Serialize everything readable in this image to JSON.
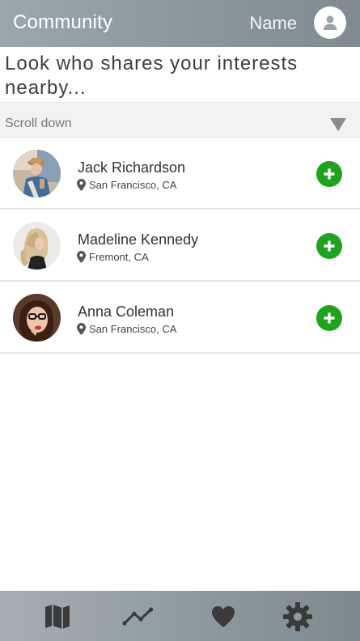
{
  "header": {
    "title": "Community",
    "user_label": "Name"
  },
  "intro_text": "Look who shares your interests nearby...",
  "scroll_bar": {
    "label": "Scroll down"
  },
  "people": [
    {
      "name": "Jack Richardson",
      "location": "San Francisco, CA"
    },
    {
      "name": "Madeline Kennedy",
      "location": "Fremont, CA"
    },
    {
      "name": "Anna Coleman",
      "location": "San Francisco, CA"
    }
  ],
  "bottom_nav": [
    {
      "icon": "map-icon"
    },
    {
      "icon": "trend-icon"
    },
    {
      "icon": "heart-icon"
    },
    {
      "icon": "gear-icon"
    }
  ],
  "colors": {
    "header": "#8c989e",
    "add_button": "#1fa31f",
    "nav_icon": "#3a3a3a"
  }
}
